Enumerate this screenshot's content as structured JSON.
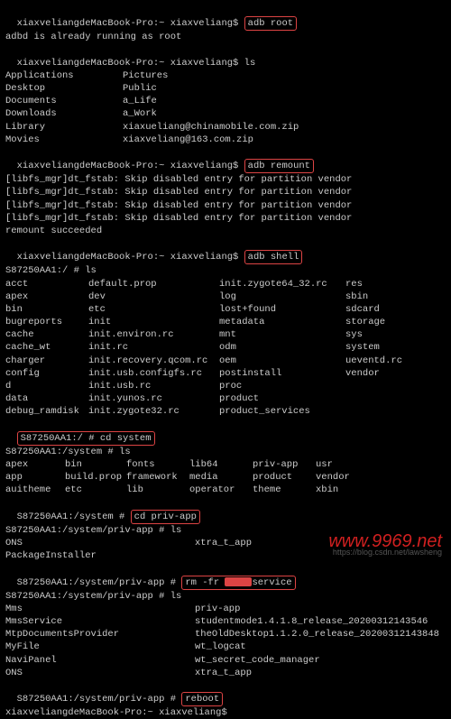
{
  "host_prompt": "xiaxveliangdeMacBook-Pro:~ xiaxveliang$",
  "cmds": {
    "adb_root": "adb root",
    "ls": "ls",
    "adb_remount": "adb remount",
    "adb_shell": "adb shell",
    "cd_system": "cd system",
    "cd_priv_app": "cd priv-app",
    "rm_prefix": "rm -fr ",
    "rm_suffix": "service",
    "reboot": "reboot"
  },
  "msgs": {
    "already_root": "adbd is already running as root",
    "libfs": "[libfs_mgr]dt_fstab: Skip disabled entry for partition vendor",
    "remount_ok": "remount succeeded"
  },
  "shell": {
    "root": "S87250AA1:/ # ",
    "root_ls": "S87250AA1:/ # ls",
    "system": "S87250AA1:/system # ",
    "system_ls": "S87250AA1:/system # ls",
    "priv": "S87250AA1:/system/priv-app # ",
    "priv_ls": "S87250AA1:/system/priv-app # ls"
  },
  "mac_ls": {
    "l": [
      "Applications",
      "Desktop",
      "Documents",
      "Downloads",
      "Library",
      "Movies"
    ],
    "r": [
      "Pictures",
      "Public",
      "a_Life",
      "a_Work",
      "xiaxueliang@chinamobile.com.zip",
      "xiaxveliang@163.com.zip"
    ]
  },
  "root_ls": [
    [
      "acct",
      "default.prop",
      "init.zygote64_32.rc",
      "res"
    ],
    [
      "apex",
      "dev",
      "log",
      "sbin"
    ],
    [
      "bin",
      "etc",
      "lost+found",
      "sdcard"
    ],
    [
      "bugreports",
      "init",
      "metadata",
      "storage"
    ],
    [
      "cache",
      "init.environ.rc",
      "mnt",
      "sys"
    ],
    [
      "cache_wt",
      "init.rc",
      "odm",
      "system"
    ],
    [
      "charger",
      "init.recovery.qcom.rc",
      "oem",
      "ueventd.rc"
    ],
    [
      "config",
      "init.usb.configfs.rc",
      "postinstall",
      "vendor"
    ],
    [
      "d",
      "init.usb.rc",
      "proc",
      ""
    ],
    [
      "data",
      "init.yunos.rc",
      "product",
      ""
    ],
    [
      "debug_ramdisk",
      "init.zygote32.rc",
      "product_services",
      ""
    ]
  ],
  "system_ls": [
    [
      "apex",
      "bin",
      "fonts",
      "lib64",
      "priv-app",
      "usr"
    ],
    [
      "app",
      "build.prop",
      "framework",
      "media",
      "product",
      "vendor"
    ],
    [
      "auitheme",
      "etc",
      "lib",
      "operator",
      "theme",
      "xbin"
    ]
  ],
  "priv_ls1": {
    "l": [
      "ONS",
      "PackageInstaller"
    ],
    "r": [
      "xtra_t_app",
      ""
    ]
  },
  "priv_ls2": {
    "l": [
      "Mms",
      "MmsService",
      "MtpDocumentsProvider",
      "MyFile",
      "NaviPanel",
      "ONS"
    ],
    "r": [
      "priv-app",
      "studentmode1.4.1.8_release_20200312143546",
      "theOldDesktop1.1.2.0_release_20200312143848",
      "wt_logcat",
      "wt_secret_code_manager",
      "xtra_t_app"
    ]
  },
  "watermark": "www.9969.net",
  "credit": "https://blog.csdn.net/lawsheng"
}
